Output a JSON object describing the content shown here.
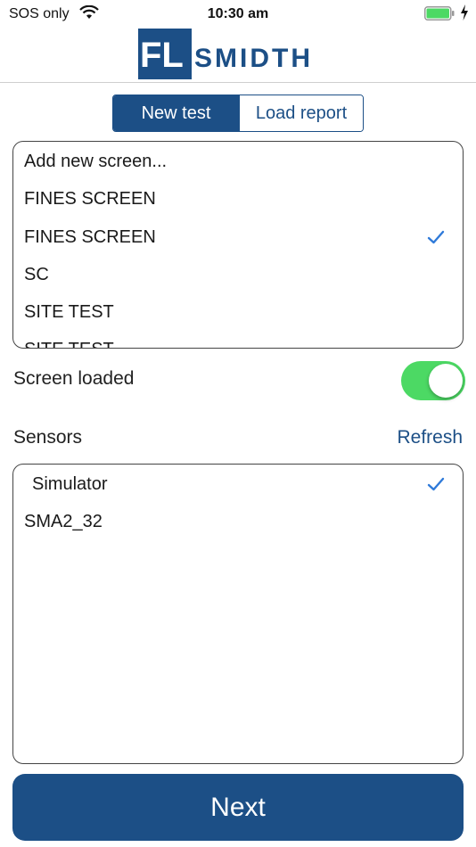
{
  "status_bar": {
    "carrier": "SOS only",
    "time": "10:30 am",
    "wifi_icon": "wifi-icon",
    "battery_icon": "battery-icon",
    "battery_level": 1.0,
    "charging_icon": "charging-bolt-icon"
  },
  "header": {
    "logo_text": "FLSMIDTH",
    "brand_color": "#1c4f86"
  },
  "segmented": {
    "new_test": "New test",
    "load_report": "Load report",
    "selected": "New test"
  },
  "screens": {
    "items": [
      {
        "label": "Add new screen...",
        "checked": false
      },
      {
        "label": "FINES SCREEN",
        "checked": false
      },
      {
        "label": "FINES SCREEN",
        "checked": true
      },
      {
        "label": "SC",
        "checked": false
      },
      {
        "label": "SITE TEST",
        "checked": false
      },
      {
        "label": "SITE TEST",
        "checked": false
      }
    ]
  },
  "screen_loaded": {
    "label": "Screen loaded",
    "on": true,
    "on_color": "#4cd964"
  },
  "sensors": {
    "title": "Sensors",
    "refresh": "Refresh",
    "items": [
      {
        "label": "Simulator",
        "checked": true
      },
      {
        "label": "SMA2_32",
        "checked": false
      }
    ]
  },
  "next_button": {
    "label": "Next"
  },
  "check_color": "#2f7ad9"
}
